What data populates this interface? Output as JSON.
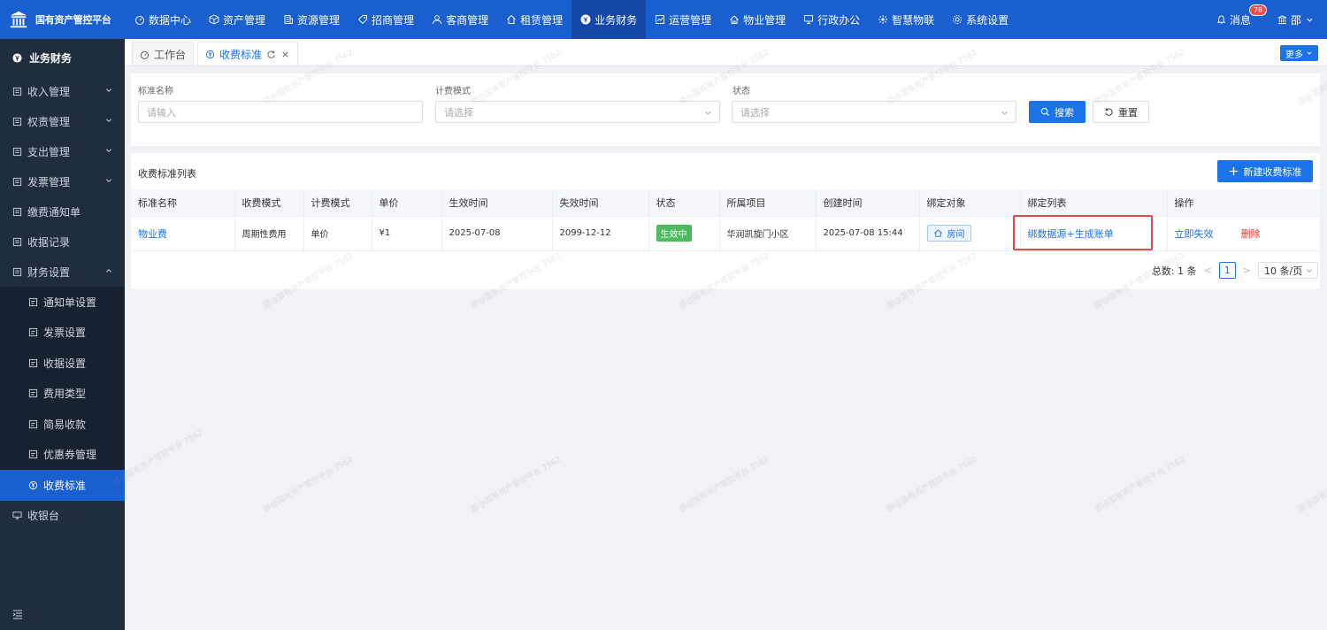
{
  "brand": {
    "title": "国有资产管控平台"
  },
  "topnav": [
    {
      "label": "数据中心",
      "icon": "dashboard-icon"
    },
    {
      "label": "资产管理",
      "icon": "box-icon"
    },
    {
      "label": "资源管理",
      "icon": "building-icon"
    },
    {
      "label": "招商管理",
      "icon": "tag-icon"
    },
    {
      "label": "客商管理",
      "icon": "users-icon"
    },
    {
      "label": "租赁管理",
      "icon": "home-icon"
    },
    {
      "label": "业务财务",
      "icon": "finance-icon",
      "active": true
    },
    {
      "label": "运营管理",
      "icon": "chart-icon"
    },
    {
      "label": "物业管理",
      "icon": "house-icon"
    },
    {
      "label": "行政办公",
      "icon": "monitor-icon"
    },
    {
      "label": "智慧物联",
      "icon": "iot-icon"
    },
    {
      "label": "系统设置",
      "icon": "settings-icon"
    }
  ],
  "top_right": {
    "message_label": "消息",
    "message_count": "78",
    "user_name": "邵"
  },
  "sidebar": {
    "head": "业务财务",
    "items": [
      {
        "label": "收入管理",
        "expandable": true
      },
      {
        "label": "权责管理",
        "expandable": true
      },
      {
        "label": "支出管理",
        "expandable": true
      },
      {
        "label": "发票管理",
        "expandable": true
      },
      {
        "label": "缴费通知单",
        "expandable": false
      },
      {
        "label": "收据记录",
        "expandable": false
      },
      {
        "label": "财务设置",
        "expandable": true,
        "expanded": true
      }
    ],
    "subitems": [
      {
        "label": "通知单设置"
      },
      {
        "label": "发票设置"
      },
      {
        "label": "收据设置"
      },
      {
        "label": "费用类型"
      },
      {
        "label": "简易收款"
      },
      {
        "label": "优惠券管理"
      },
      {
        "label": "收费标准",
        "active": true
      }
    ],
    "after": {
      "label": "收银台"
    }
  },
  "tabs": [
    {
      "label": "工作台"
    },
    {
      "label": "收费标准",
      "active": true
    }
  ],
  "more_label": "更多",
  "filter": {
    "name_label": "标准名称",
    "name_placeholder": "请输入",
    "mode_label": "计费模式",
    "mode_placeholder": "请选择",
    "status_label": "状态",
    "status_placeholder": "请选择",
    "search_label": "搜索",
    "reset_label": "重置"
  },
  "list": {
    "title": "收费标准列表",
    "new_label": "新建收费标准",
    "columns": [
      "标准名称",
      "收费模式",
      "计费模式",
      "单价",
      "生效时间",
      "失效时间",
      "状态",
      "所属项目",
      "创建时间",
      "绑定对象",
      "绑定列表",
      "操作"
    ],
    "rows": [
      {
        "name": "物业费",
        "charge_mode": "周期性费用",
        "billing_mode": "单价",
        "price": "¥1",
        "start": "2025-07-08",
        "end": "2099-12-12",
        "status": "生效中",
        "project": "华润凯旋门小区",
        "created": "2025-07-08 15:44",
        "bind_object": "房间",
        "bind_list": "绑数据源+生成账单",
        "action_disable": "立即失效",
        "action_delete": "删除"
      }
    ]
  },
  "pager": {
    "total": "总数: 1 条",
    "current": "1",
    "size": "10 条/页"
  },
  "watermark": "邵@国有资产管控平台 7562"
}
